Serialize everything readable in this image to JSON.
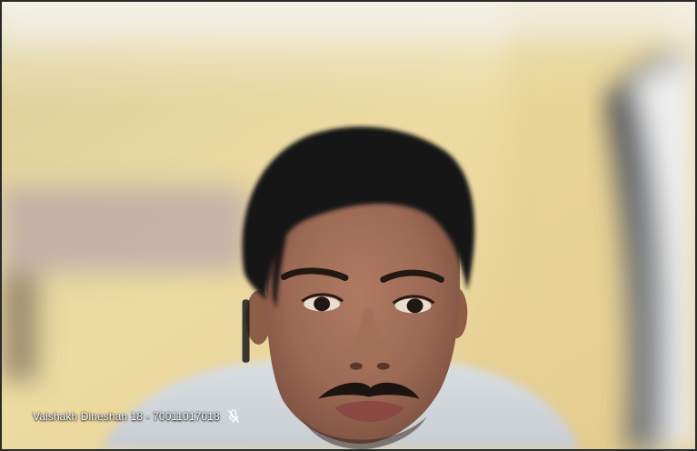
{
  "participant": {
    "name_label": "Vaishakh Dineshan 18 - 70011017018",
    "mic_icon": "mic-muted-icon",
    "video_feed": "participant-camera-feed"
  },
  "colors": {
    "wall": "#e9d49e",
    "name_text": "#ffffff"
  }
}
